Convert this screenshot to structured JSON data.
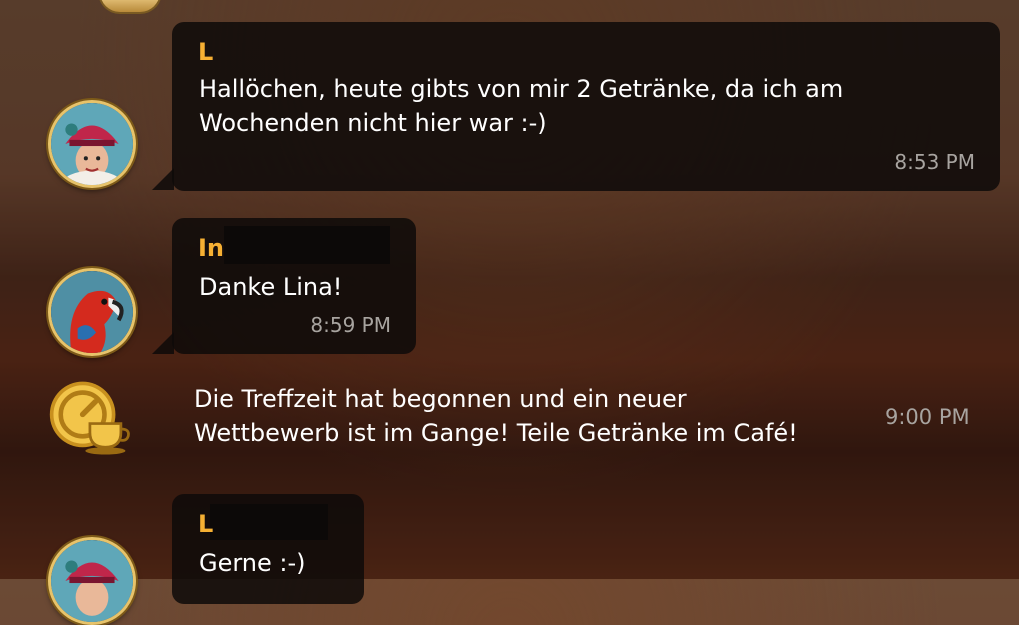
{
  "messages": [
    {
      "sender": "L",
      "text_line1": "Hallöchen, heute gibts von mir 2 Getränke, da ich am",
      "text_line2": "Wochenden nicht hier war :-)",
      "time": "8:53 PM"
    },
    {
      "sender": "In",
      "text": "Danke Lina!",
      "time": "8:59 PM"
    },
    {
      "system_line1": "Die Treffzeit hat begonnen und ein neuer",
      "system_line2": "Wettbewerb ist im Gange! Teile Getränke im Café!",
      "time": "9:00 PM"
    },
    {
      "sender": "L",
      "text": "Gerne :-)"
    }
  ],
  "icons": {
    "avatar1": "woman-red-hat-avatar",
    "avatar2": "parrot-avatar",
    "system": "timer-coffee-cup-icon",
    "avatar4": "woman-red-hat-avatar"
  },
  "colors": {
    "sender_name": "#f6b033",
    "bubble": "#0e0a09",
    "time": "#a8a4a0",
    "avatar_border": "#e7c36a"
  }
}
